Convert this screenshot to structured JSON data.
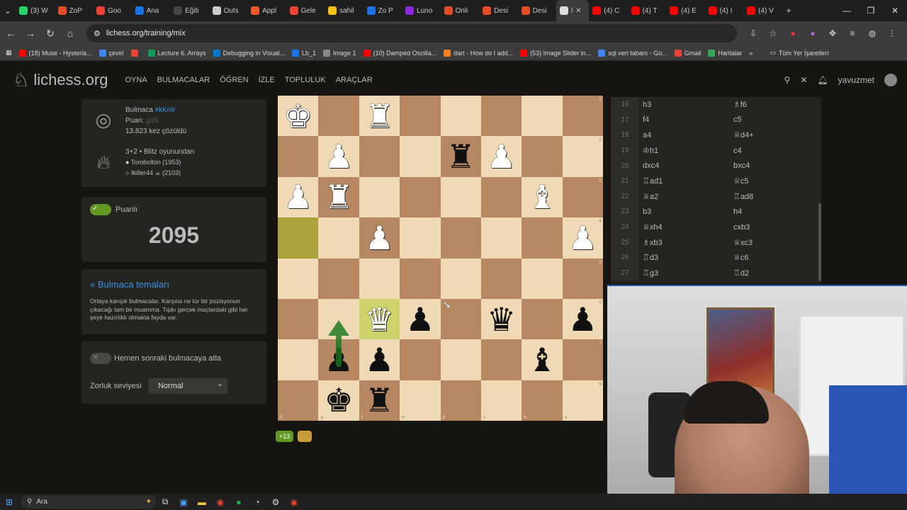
{
  "browser": {
    "tabs": [
      {
        "label": "(3) W",
        "color": "#25d366"
      },
      {
        "label": "ZoP",
        "color": "#e44d26"
      },
      {
        "label": "Goo",
        "color": "#ea4335"
      },
      {
        "label": "Ana",
        "color": "#1a73e8"
      },
      {
        "label": "Eğiti",
        "color": "#444444"
      },
      {
        "label": "Outs",
        "color": "#cccccc"
      },
      {
        "label": "Appl",
        "color": "#f1592a"
      },
      {
        "label": "Gele",
        "color": "#ea4335"
      },
      {
        "label": "sahil",
        "color": "#f4c20d"
      },
      {
        "label": "Zo P",
        "color": "#1a73e8"
      },
      {
        "label": "Luno",
        "color": "#8a2be2"
      },
      {
        "label": "Onli",
        "color": "#e44d26"
      },
      {
        "label": "Desi",
        "color": "#e44d26"
      },
      {
        "label": "Desi",
        "color": "#e44d26"
      },
      {
        "label": "l",
        "color": "#dddddd",
        "active": true
      },
      {
        "label": "(4) C",
        "color": "#ff0000"
      },
      {
        "label": "(4) T",
        "color": "#ff0000"
      },
      {
        "label": "(4) E",
        "color": "#ff0000"
      },
      {
        "label": "(4) I",
        "color": "#ff0000"
      },
      {
        "label": "(4) V",
        "color": "#ff0000"
      }
    ],
    "new_tab": "+",
    "url": "lichess.org/training/mix",
    "bookmarks": [
      {
        "label": "(18) Muse - Hysteria...",
        "color": "#ff0000"
      },
      {
        "label": "çeviri",
        "color": "#4285f4"
      },
      {
        "label": "",
        "color": "#ea4335"
      },
      {
        "label": "Lecture 6. Arrays",
        "color": "#0f9d58"
      },
      {
        "label": "Debugging in Visual...",
        "color": "#007acc"
      },
      {
        "label": "Lb_1",
        "color": "#1a73e8"
      },
      {
        "label": "Image 1",
        "color": "#888888"
      },
      {
        "label": "(10) Damped Oscilla...",
        "color": "#ff0000"
      },
      {
        "label": "dart - How do I add...",
        "color": "#f48024"
      },
      {
        "label": "(53) Image Slider in...",
        "color": "#ff0000"
      },
      {
        "label": "sql veri tabanı - Go...",
        "color": "#4285f4"
      },
      {
        "label": "Gmail",
        "color": "#ea4335"
      },
      {
        "label": "Haritalar",
        "color": "#34a853"
      }
    ],
    "bookmarks_more": "»",
    "all_bookmarks": "Tüm Yer İşaretleri"
  },
  "site": {
    "logo": "lichess.org",
    "nav": [
      "OYNA",
      "BULMACALAR",
      "ÖĞREN",
      "İZLE",
      "TOPLULUK",
      "ARAÇLAR"
    ],
    "username": "yavuzmet"
  },
  "puzzle": {
    "label": "Bulmaca",
    "id": "#kKnIr",
    "rating_label": "Puan:",
    "rating_value": "gizli",
    "solved": "13.823 kez çözüldü",
    "game_type": "3+2 • Blitz oyunundan",
    "white_player": "Torobolton (1953)",
    "black_player": "Ikiller44 ☕ (2103)"
  },
  "rated": {
    "label": "Puanlı",
    "score": "2095"
  },
  "themes": {
    "title": "« Bulmaca temaları",
    "description": "Ortaya karışık bulmacalar. Karşına ne tür bir pozisyonun çıkacağı tam bir muamma. Tıpkı gerçek maçlardaki gibi her şeye hazırlıklı olmakta fayda var."
  },
  "settings": {
    "skip_label": "Hemen sonraki bulmacaya atla",
    "difficulty_label": "Zorluk seviyesi",
    "difficulty_value": "Normal"
  },
  "board": {
    "orientation": "black",
    "files": [
      "h",
      "g",
      "f",
      "e",
      "d",
      "c",
      "b",
      "a"
    ],
    "ranks": [
      "1",
      "2",
      "3",
      "4",
      "5",
      "6",
      "7",
      "8"
    ],
    "rows": [
      [
        {
          "p": "♚",
          "c": "w"
        },
        null,
        {
          "p": "♜",
          "c": "w"
        },
        null,
        null,
        null,
        null,
        null
      ],
      [
        null,
        {
          "p": "♟",
          "c": "w"
        },
        null,
        null,
        {
          "p": "♜",
          "c": "b"
        },
        {
          "p": "♟",
          "c": "w"
        },
        null,
        null
      ],
      [
        {
          "p": "♟",
          "c": "w"
        },
        {
          "p": "♜",
          "c": "w"
        },
        null,
        null,
        null,
        null,
        {
          "p": "♝",
          "c": "w"
        },
        null
      ],
      [
        null,
        null,
        {
          "p": "♟",
          "c": "w"
        },
        null,
        null,
        null,
        null,
        {
          "p": "♟",
          "c": "w"
        }
      ],
      [
        null,
        null,
        null,
        null,
        null,
        null,
        null,
        null
      ],
      [
        null,
        null,
        {
          "p": "♛",
          "c": "w"
        },
        {
          "p": "♟",
          "c": "b"
        },
        null,
        {
          "p": "♛",
          "c": "b"
        },
        null,
        {
          "p": "♟",
          "c": "b"
        }
      ],
      [
        null,
        {
          "p": "♟",
          "c": "b"
        },
        {
          "p": "♟",
          "c": "b"
        },
        null,
        null,
        null,
        {
          "p": "♝",
          "c": "b"
        },
        null
      ],
      [
        null,
        {
          "p": "♚",
          "c": "b"
        },
        {
          "p": "♜",
          "c": "b"
        },
        null,
        null,
        null,
        null,
        null
      ]
    ],
    "highlights": [
      {
        "row": 3,
        "col": 0,
        "kind": "last-from"
      },
      {
        "row": 5,
        "col": 2,
        "kind": "last-to"
      }
    ],
    "arrow_color": "#15781b"
  },
  "below_board": {
    "badge": "+13",
    "badge_color": "#629924",
    "chip_color": "#c89b3c"
  },
  "moves": [
    {
      "n": "16",
      "w": "h3",
      "b": "♗f6"
    },
    {
      "n": "17",
      "w": "f4",
      "b": "c5"
    },
    {
      "n": "18",
      "w": "a4",
      "b": "♕d4+"
    },
    {
      "n": "19",
      "w": "♔h1",
      "b": "c4"
    },
    {
      "n": "20",
      "w": "dxc4",
      "b": "bxc4"
    },
    {
      "n": "21",
      "w": "♖ad1",
      "b": "♕c5"
    },
    {
      "n": "22",
      "w": "♕a2",
      "b": "♖ad8"
    },
    {
      "n": "23",
      "w": "b3",
      "b": "h4"
    },
    {
      "n": "24",
      "w": "♕xh4",
      "b": "cxb3"
    },
    {
      "n": "25",
      "w": "♗xb3",
      "b": "♕xc3"
    },
    {
      "n": "26",
      "w": "♖d3",
      "b": "♕c6"
    },
    {
      "n": "27",
      "w": "♖g3",
      "b": "♖d2"
    }
  ],
  "taskbar": {
    "search_placeholder": "Ara"
  }
}
